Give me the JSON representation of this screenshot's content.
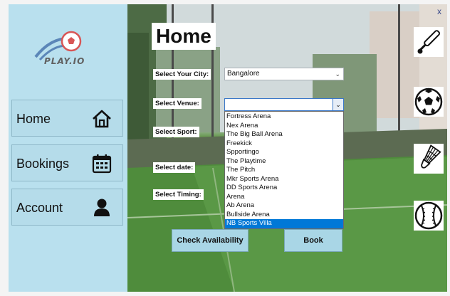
{
  "app": {
    "logo_text": "PLAY.IO",
    "close_label": "x"
  },
  "sidebar": {
    "items": [
      {
        "label": "Home",
        "icon": "home-icon"
      },
      {
        "label": "Bookings",
        "icon": "calendar-icon"
      },
      {
        "label": "Account",
        "icon": "user-icon"
      }
    ]
  },
  "main": {
    "title": "Home",
    "city_label": "Select Your City:",
    "city_value": "Bangalore",
    "venue_label": "Select Venue:",
    "venue_value": "",
    "sport_label": "Select Sport:",
    "date_label": "Select date:",
    "timing_label": "Select Timing:",
    "venue_options": [
      "Fortress Arena",
      "Nex Arena",
      "The Big Ball Arena",
      "Freekick",
      "Spportingo",
      "The Playtime",
      "The Pitch",
      "Mkr Sports Arena",
      "DD Sports Arena",
      "Arena",
      "Ab Arena",
      "Bullside Arena",
      "NB Sports Villa"
    ],
    "selected_venue_option": "NB Sports Villa",
    "check_button": "Check Availability",
    "book_button": "Book"
  },
  "sports": [
    "cricket-icon",
    "football-icon",
    "badminton-icon",
    "baseball-icon"
  ],
  "colors": {
    "sidebar": "#b9e0ee",
    "button": "#a9d6e6",
    "selection": "#0078d7"
  }
}
